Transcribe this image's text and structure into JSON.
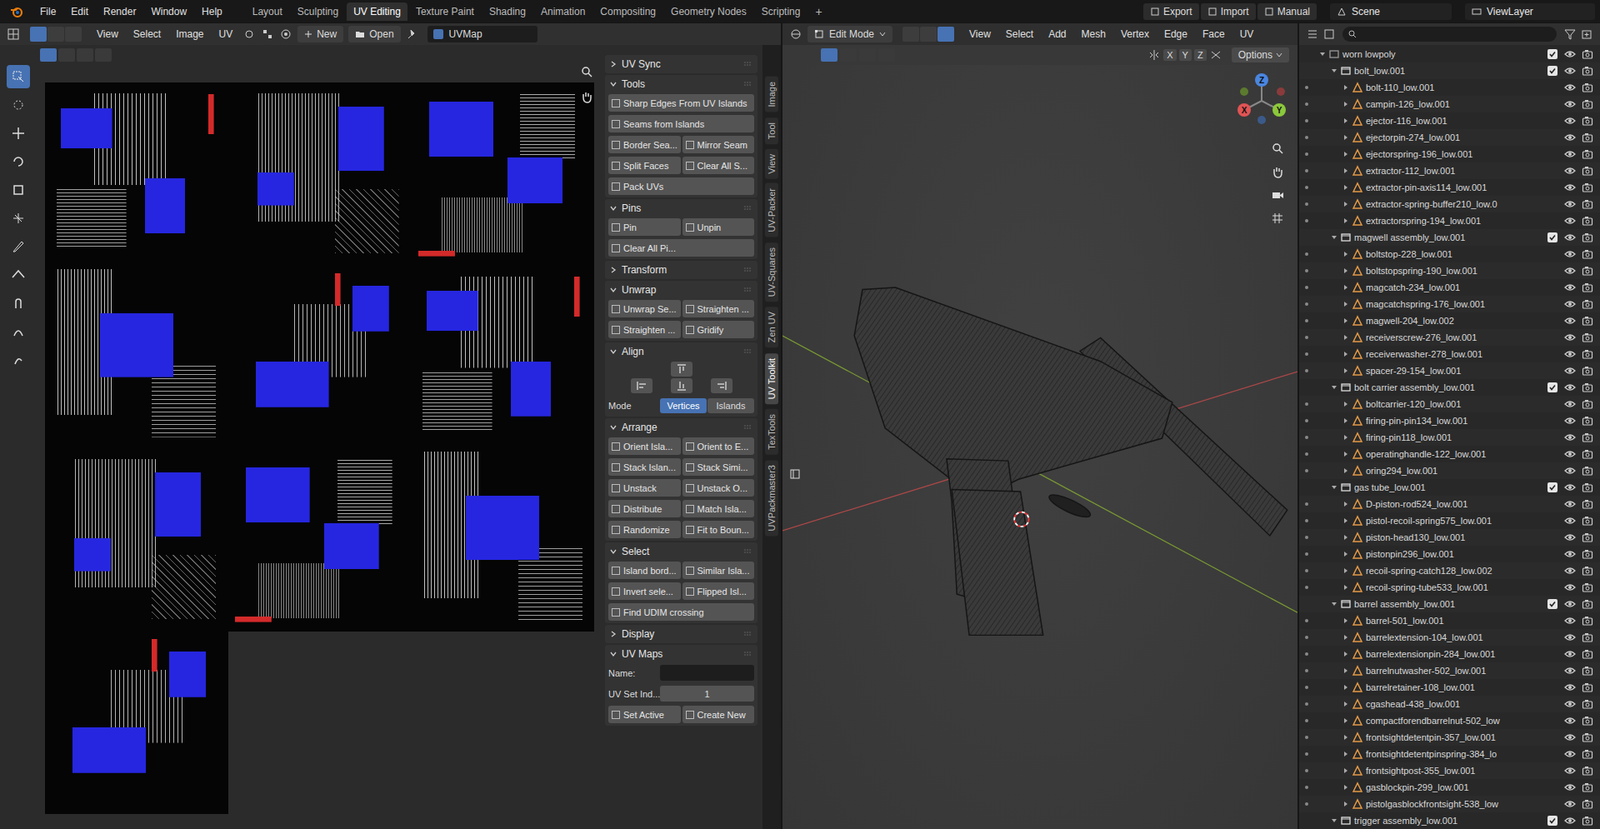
{
  "top_bar": {
    "menu": [
      "File",
      "Edit",
      "Render",
      "Window",
      "Help"
    ],
    "workspaces": [
      {
        "label": "Layout",
        "selected": false
      },
      {
        "label": "Sculpting",
        "selected": false
      },
      {
        "label": "UV Editing",
        "selected": true
      },
      {
        "label": "Texture Paint",
        "selected": false
      },
      {
        "label": "Shading",
        "selected": false
      },
      {
        "label": "Animation",
        "selected": false
      },
      {
        "label": "Compositing",
        "selected": false
      },
      {
        "label": "Geometry Nodes",
        "selected": false
      },
      {
        "label": "Scripting",
        "selected": false
      }
    ],
    "add_workspace": "+",
    "actions": [
      "Export",
      "Import",
      "Manual"
    ],
    "scene": "Scene",
    "view_layer": "ViewLayer"
  },
  "uv_editor": {
    "menu": [
      "View",
      "Select",
      "Image",
      "UV"
    ],
    "new_button": "New",
    "open_button": "Open",
    "uv_map": "UVMap",
    "tools": [
      {
        "selected": true
      },
      {
        "selected": false
      },
      {
        "selected": false
      },
      {
        "selected": false
      },
      {
        "selected": false
      },
      {
        "selected": false
      },
      {
        "selected": false
      },
      {
        "selected": false
      },
      {
        "selected": false
      },
      {
        "selected": false
      },
      {
        "selected": false
      }
    ]
  },
  "n_panel": {
    "sections": [
      {
        "title": "UV Sync",
        "expanded": false,
        "rows": []
      },
      {
        "title": "Tools",
        "expanded": true,
        "rows": [
          {
            "kind": "buttons",
            "buttons": [
              "Sharp Edges From UV Islands"
            ]
          },
          {
            "kind": "buttons",
            "buttons": [
              "Seams from Islands"
            ]
          },
          {
            "kind": "buttons",
            "buttons": [
              "Border Sea...",
              "Mirror Seam"
            ]
          },
          {
            "kind": "buttons",
            "buttons": [
              "Split Faces",
              "Clear All S..."
            ]
          },
          {
            "kind": "buttons",
            "buttons": [
              "Pack UVs"
            ]
          }
        ]
      },
      {
        "title": "Pins",
        "expanded": true,
        "rows": [
          {
            "kind": "buttons",
            "buttons": [
              "Pin",
              "Unpin"
            ]
          },
          {
            "kind": "buttons",
            "buttons": [
              "Clear All Pi..."
            ]
          }
        ]
      },
      {
        "title": "Transform",
        "expanded": false,
        "rows": []
      },
      {
        "title": "Unwrap",
        "expanded": true,
        "rows": [
          {
            "kind": "buttons",
            "buttons": [
              "Unwrap Se...",
              "Straighten ..."
            ]
          },
          {
            "kind": "buttons",
            "buttons": [
              "Straighten ...",
              "Gridify"
            ]
          }
        ]
      },
      {
        "title": "Align",
        "expanded": true,
        "rows": [
          {
            "kind": "align"
          },
          {
            "kind": "toggle",
            "label": "Mode",
            "options": [
              {
                "label": "Vertices",
                "selected": true
              },
              {
                "label": "Islands",
                "selected": false
              }
            ]
          }
        ]
      },
      {
        "title": "Arrange",
        "expanded": true,
        "rows": [
          {
            "kind": "buttons",
            "buttons": [
              "Orient Isla...",
              "Orient to E..."
            ]
          },
          {
            "kind": "buttons",
            "buttons": [
              "Stack Islan...",
              "Stack Simi..."
            ]
          },
          {
            "kind": "buttons",
            "buttons": [
              "Unstack",
              "Unstack O..."
            ]
          },
          {
            "kind": "buttons",
            "buttons": [
              "Distribute",
              "Match Isla..."
            ]
          },
          {
            "kind": "buttons",
            "buttons": [
              "Randomize",
              "Fit to Boun..."
            ]
          }
        ]
      },
      {
        "title": "Select",
        "expanded": true,
        "rows": [
          {
            "kind": "buttons",
            "buttons": [
              "Island bord...",
              "Similar Isla..."
            ]
          },
          {
            "kind": "buttons",
            "buttons": [
              "Invert sele...",
              "Flipped Isl..."
            ]
          },
          {
            "kind": "buttons",
            "buttons": [
              "Find UDIM crossing"
            ]
          }
        ]
      },
      {
        "title": "Display",
        "expanded": false,
        "rows": []
      },
      {
        "title": "UV Maps",
        "expanded": true,
        "rows": [
          {
            "kind": "field",
            "label": "Name:",
            "value": ""
          },
          {
            "kind": "field",
            "label": "UV Set Ind...",
            "value": "1"
          },
          {
            "kind": "buttons",
            "buttons": [
              "Set Active",
              "Create New"
            ]
          }
        ]
      }
    ]
  },
  "side_tabs": [
    {
      "label": "Image",
      "selected": false
    },
    {
      "label": "Tool",
      "selected": false
    },
    {
      "label": "View",
      "selected": false
    },
    {
      "label": "UV-Packer",
      "selected": false
    },
    {
      "label": "UV-Squares",
      "selected": false
    },
    {
      "label": "Zen UV",
      "selected": false
    },
    {
      "label": "UV Toolkit",
      "selected": true
    },
    {
      "label": "TexTools",
      "selected": false
    },
    {
      "label": "UVPackmaster3",
      "selected": false
    }
  ],
  "viewport": {
    "mode": "Edit Mode",
    "menu": [
      "View",
      "Select",
      "Add",
      "Mesh",
      "Vertex",
      "Edge",
      "Face",
      "UV"
    ],
    "mirror_axes": [
      "X",
      "Y",
      "Z"
    ],
    "options": "Options",
    "gizmo_axes": [
      "X",
      "Y",
      "Z"
    ]
  },
  "outliner": {
    "items": [
      {
        "name": "worn lowpoly",
        "depth": 0,
        "kind": "scene",
        "expanded": true,
        "checked": true
      },
      {
        "name": "bolt_low.001",
        "depth": 1,
        "kind": "collection",
        "expanded": true,
        "checked": true
      },
      {
        "name": "bolt-110_low.001",
        "depth": 2,
        "kind": "object",
        "expanded": false,
        "checked": false
      },
      {
        "name": "campin-126_low.001",
        "depth": 2,
        "kind": "object",
        "expanded": false,
        "checked": false
      },
      {
        "name": "ejector-116_low.001",
        "depth": 2,
        "kind": "object",
        "expanded": false,
        "checked": false
      },
      {
        "name": "ejectorpin-274_low.001",
        "depth": 2,
        "kind": "object",
        "expanded": false,
        "checked": false
      },
      {
        "name": "ejectorspring-196_low.001",
        "depth": 2,
        "kind": "object",
        "expanded": false,
        "checked": false
      },
      {
        "name": "extractor-112_low.001",
        "depth": 2,
        "kind": "object",
        "expanded": false,
        "checked": false
      },
      {
        "name": "extractor-pin-axis114_low.001",
        "depth": 2,
        "kind": "object",
        "expanded": false,
        "checked": false
      },
      {
        "name": "extractor-spring-buffer210_low.0",
        "depth": 2,
        "kind": "object",
        "expanded": false,
        "checked": false
      },
      {
        "name": "extractorspring-194_low.001",
        "depth": 2,
        "kind": "object",
        "expanded": false,
        "checked": false
      },
      {
        "name": "magwell assembly_low.001",
        "depth": 1,
        "kind": "collection",
        "expanded": true,
        "checked": true
      },
      {
        "name": "boltstop-228_low.001",
        "depth": 2,
        "kind": "object",
        "expanded": false,
        "checked": false
      },
      {
        "name": "boltstopspring-190_low.001",
        "depth": 2,
        "kind": "object",
        "expanded": false,
        "checked": false
      },
      {
        "name": "magcatch-234_low.001",
        "depth": 2,
        "kind": "object",
        "expanded": false,
        "checked": false
      },
      {
        "name": "magcatchspring-176_low.001",
        "depth": 2,
        "kind": "object",
        "expanded": false,
        "checked": false
      },
      {
        "name": "magwell-204_low.002",
        "depth": 2,
        "kind": "object",
        "expanded": false,
        "checked": false
      },
      {
        "name": "receiverscrew-276_low.001",
        "depth": 2,
        "kind": "object",
        "expanded": false,
        "checked": false
      },
      {
        "name": "receiverwasher-278_low.001",
        "depth": 2,
        "kind": "object",
        "expanded": false,
        "checked": false
      },
      {
        "name": "spacer-29-154_low.001",
        "depth": 2,
        "kind": "object",
        "expanded": false,
        "checked": false
      },
      {
        "name": "bolt carrier assembly_low.001",
        "depth": 1,
        "kind": "collection",
        "expanded": true,
        "checked": true
      },
      {
        "name": "boltcarrier-120_low.001",
        "depth": 2,
        "kind": "object",
        "expanded": false,
        "checked": false
      },
      {
        "name": "firing-pin-pin134_low.001",
        "depth": 2,
        "kind": "object",
        "expanded": false,
        "checked": false
      },
      {
        "name": "firing-pin118_low.001",
        "depth": 2,
        "kind": "object",
        "expanded": false,
        "checked": false
      },
      {
        "name": "operatinghandle-122_low.001",
        "depth": 2,
        "kind": "object",
        "expanded": false,
        "checked": false
      },
      {
        "name": "oring294_low.001",
        "depth": 2,
        "kind": "object",
        "expanded": false,
        "checked": false
      },
      {
        "name": "gas tube_low.001",
        "depth": 1,
        "kind": "collection",
        "expanded": true,
        "checked": true
      },
      {
        "name": "D-piston-rod524_low.001",
        "depth": 2,
        "kind": "object",
        "expanded": false,
        "checked": false
      },
      {
        "name": "pistol-recoil-spring575_low.001",
        "depth": 2,
        "kind": "object",
        "expanded": false,
        "checked": false
      },
      {
        "name": "piston-head130_low.001",
        "depth": 2,
        "kind": "object",
        "expanded": false,
        "checked": false
      },
      {
        "name": "pistonpin296_low.001",
        "depth": 2,
        "kind": "object",
        "expanded": false,
        "checked": false
      },
      {
        "name": "recoil-spring-catch128_low.002",
        "depth": 2,
        "kind": "object",
        "expanded": false,
        "checked": false
      },
      {
        "name": "recoil-spring-tube533_low.001",
        "depth": 2,
        "kind": "object",
        "expanded": false,
        "checked": false
      },
      {
        "name": "barrel assembly_low.001",
        "depth": 1,
        "kind": "collection",
        "expanded": true,
        "checked": true
      },
      {
        "name": "barrel-501_low.001",
        "depth": 2,
        "kind": "object",
        "expanded": false,
        "checked": false
      },
      {
        "name": "barrelextension-104_low.001",
        "depth": 2,
        "kind": "object",
        "expanded": false,
        "checked": false
      },
      {
        "name": "barrelextensionpin-284_low.001",
        "depth": 2,
        "kind": "object",
        "expanded": false,
        "checked": false
      },
      {
        "name": "barrelnutwasher-502_low.001",
        "depth": 2,
        "kind": "object",
        "expanded": false,
        "checked": false
      },
      {
        "name": "barrelretainer-108_low.001",
        "depth": 2,
        "kind": "object",
        "expanded": false,
        "checked": false
      },
      {
        "name": "cgashead-438_low.001",
        "depth": 2,
        "kind": "object",
        "expanded": false,
        "checked": false
      },
      {
        "name": "compactforendbarrelnut-502_low",
        "depth": 2,
        "kind": "object",
        "expanded": false,
        "checked": false
      },
      {
        "name": "frontsightdetentpin-357_low.001",
        "depth": 2,
        "kind": "object",
        "expanded": false,
        "checked": false
      },
      {
        "name": "frontsightdetentpinspring-384_lo",
        "depth": 2,
        "kind": "object",
        "expanded": false,
        "checked": false
      },
      {
        "name": "frontsightpost-355_low.001",
        "depth": 2,
        "kind": "object",
        "expanded": false,
        "checked": false
      },
      {
        "name": "gasblockpin-299_low.001",
        "depth": 2,
        "kind": "object",
        "expanded": false,
        "checked": false
      },
      {
        "name": "pistolgasblockfrontsight-538_low",
        "depth": 2,
        "kind": "object",
        "expanded": false,
        "checked": false
      },
      {
        "name": "trigger assembly_low.001",
        "depth": 1,
        "kind": "collection",
        "expanded": true,
        "checked": true
      }
    ]
  }
}
